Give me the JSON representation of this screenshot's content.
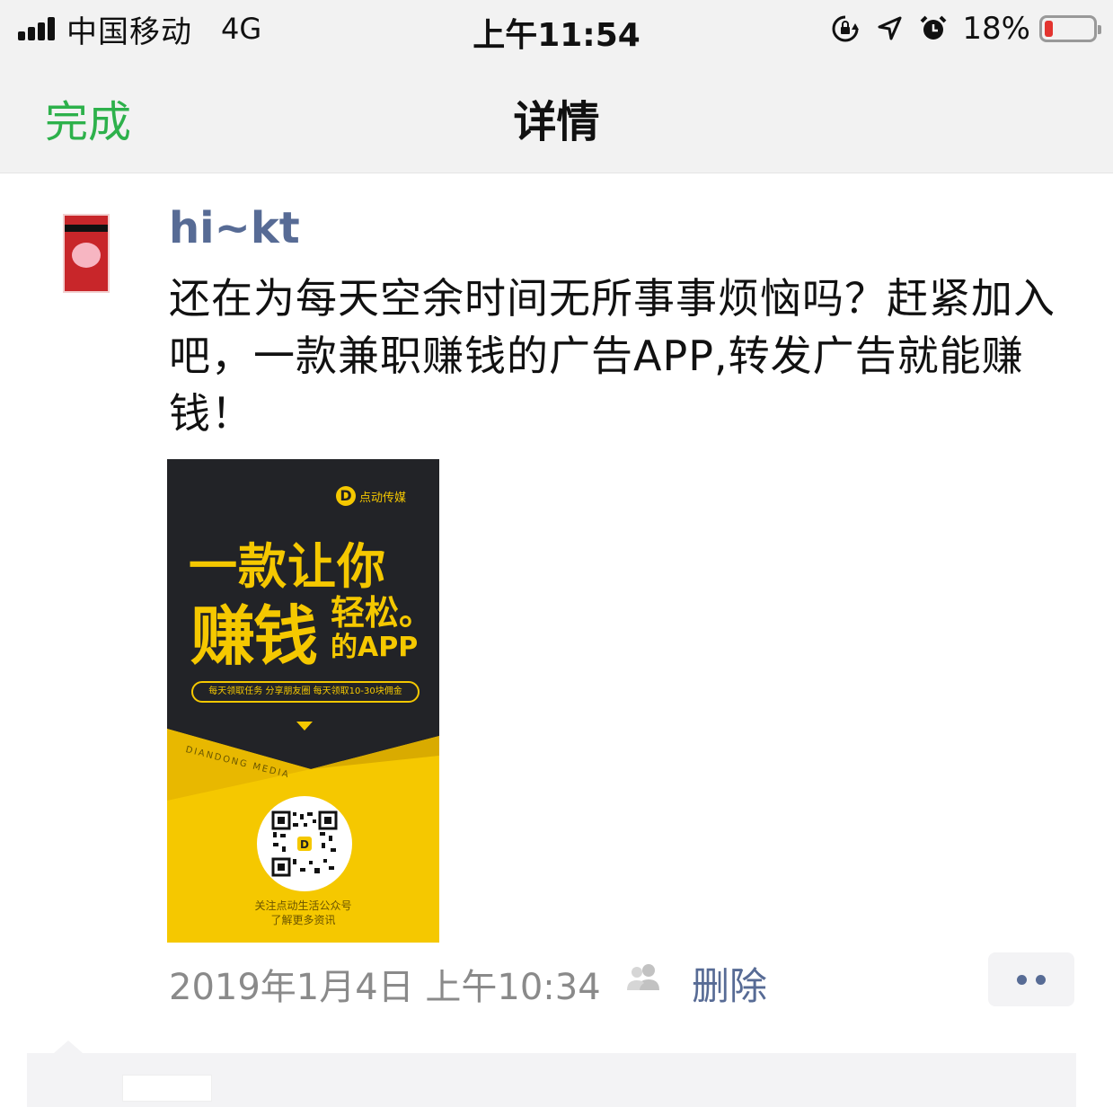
{
  "status_bar": {
    "carrier": "中国移动",
    "network": "4G",
    "time": "上午11:54",
    "battery_percent_label": "18%",
    "battery_level": 0.18,
    "battery_color": "#e3342f",
    "icons": [
      "signal-bars-icon",
      "rotation-lock-icon",
      "location-arrow-icon",
      "alarm-icon",
      "battery-icon"
    ]
  },
  "nav": {
    "done_label": "完成",
    "title": "详情",
    "accent_color": "#2db14b"
  },
  "post": {
    "username": "hi~kt",
    "text": "还在为每天空余时间无所事事烦恼吗？赶紧加入吧，一款兼职赚钱的广告APP,转发广告就能赚钱！",
    "timestamp": "2019年1月4日 上午10:34",
    "visibility_icon": "people-icon",
    "delete_label": "删除",
    "more_icon": "more-dots-icon",
    "link_color": "#576b95"
  },
  "poster": {
    "brand_logo_letter": "D",
    "brand_name": "点动传媒",
    "line1": "一款让你",
    "big_text": "赚钱",
    "small_text1": "轻松。",
    "small_text2": "的APP",
    "pill_text": "每天领取任务  分享朋友圈  每天领取10-30块佣金",
    "english_tag": "DIANDONG MEDIA",
    "footer_line1": "关注点动生活公众号",
    "footer_line2": "了解更多资讯",
    "accent_color": "#f5c800"
  }
}
